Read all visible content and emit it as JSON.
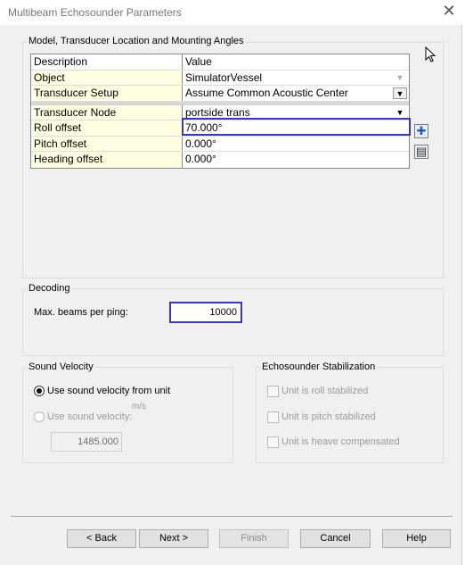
{
  "window": {
    "title": "Multibeam Echosounder Parameters",
    "close_glyph": "✕"
  },
  "model_section": {
    "legend": "Model, Transducer Location and Mounting Angles",
    "grid_header": {
      "description": "Description",
      "value": "Value"
    },
    "rows": [
      {
        "label": "Object",
        "value": "SimulatorVessel"
      },
      {
        "label": "Transducer Setup",
        "value": "Assume Common Acoustic Center"
      },
      {
        "label": "Transducer Node",
        "value": "portside trans"
      },
      {
        "label": "Roll offset",
        "value": "70.000°"
      },
      {
        "label": "Pitch offset",
        "value": "0.000°"
      },
      {
        "label": "Heading offset",
        "value": "0.000°"
      }
    ],
    "dropdown_glyph": "▼",
    "side_buttons": [
      {
        "icon": "add-icon",
        "glyph": "✚"
      },
      {
        "icon": "properties-icon",
        "glyph": "▤"
      }
    ]
  },
  "decoding": {
    "legend": "Decoding",
    "max_beams_label": "Max. beams per ping:",
    "max_beams_value": "10000"
  },
  "sound_velocity": {
    "legend": "Sound Velocity",
    "use_unit_label": "Use sound velocity from unit",
    "use_unit_checked": true,
    "use_value_label": "Use sound velocity:",
    "unit": "m/s",
    "velocity_value": "1485.000"
  },
  "stabilization": {
    "legend": "Echosounder Stabilization",
    "roll_label": "Unit is roll stabilized",
    "pitch_label": "Unit is pitch stabilized",
    "heave_label": "Unit is heave compensated"
  },
  "buttons": {
    "back": "< Back",
    "next": "Next >",
    "finish": "Finish",
    "cancel": "Cancel",
    "help": "Help"
  },
  "colors": {
    "selection_border": "#3a3aae",
    "grid_label_bg": "#ffffe1"
  }
}
